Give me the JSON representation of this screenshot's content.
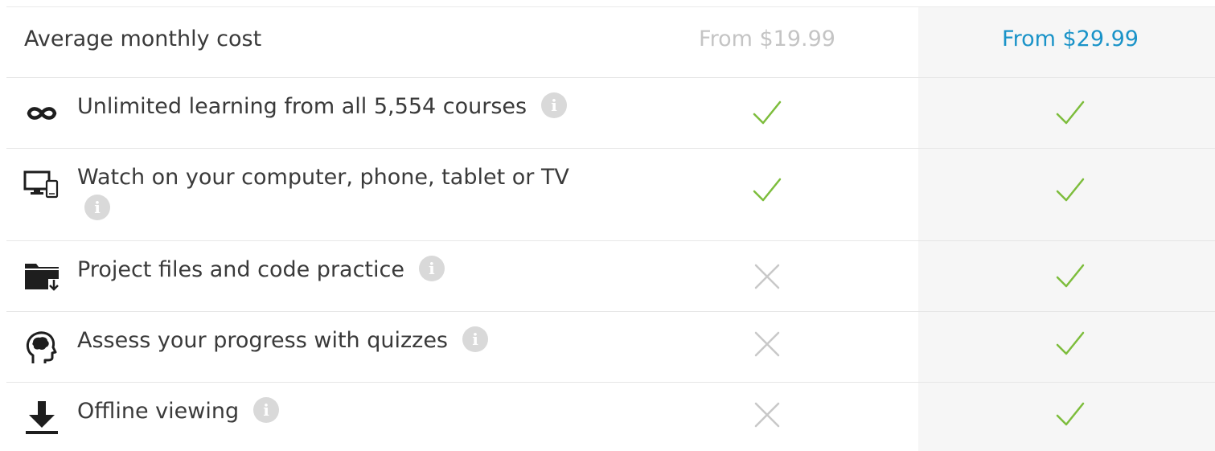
{
  "header": {
    "label": "Average monthly cost",
    "basic_price": "From $19.99",
    "premium_price": "From $29.99"
  },
  "colors": {
    "check": "#7dbd3c",
    "cross": "#c8c8c8",
    "premium_price": "#1a93c8",
    "basic_price": "#c4c4c4",
    "premium_column_bg": "#f6f6f6"
  },
  "features": [
    {
      "icon": "infinity-icon",
      "label": "Unlimited learning from all 5,554 courses",
      "info": "i",
      "basic": true,
      "premium": true
    },
    {
      "icon": "devices-icon",
      "label": "Watch on your computer, phone, tablet or TV",
      "info": "i",
      "basic": true,
      "premium": true
    },
    {
      "icon": "folder-download-icon",
      "label": "Project files and code practice",
      "info": "i",
      "basic": false,
      "premium": true
    },
    {
      "icon": "brain-head-icon",
      "label": "Assess your progress with quizzes",
      "info": "i",
      "basic": false,
      "premium": true
    },
    {
      "icon": "download-icon",
      "label": "Offline viewing",
      "info": "i",
      "basic": false,
      "premium": true
    }
  ]
}
